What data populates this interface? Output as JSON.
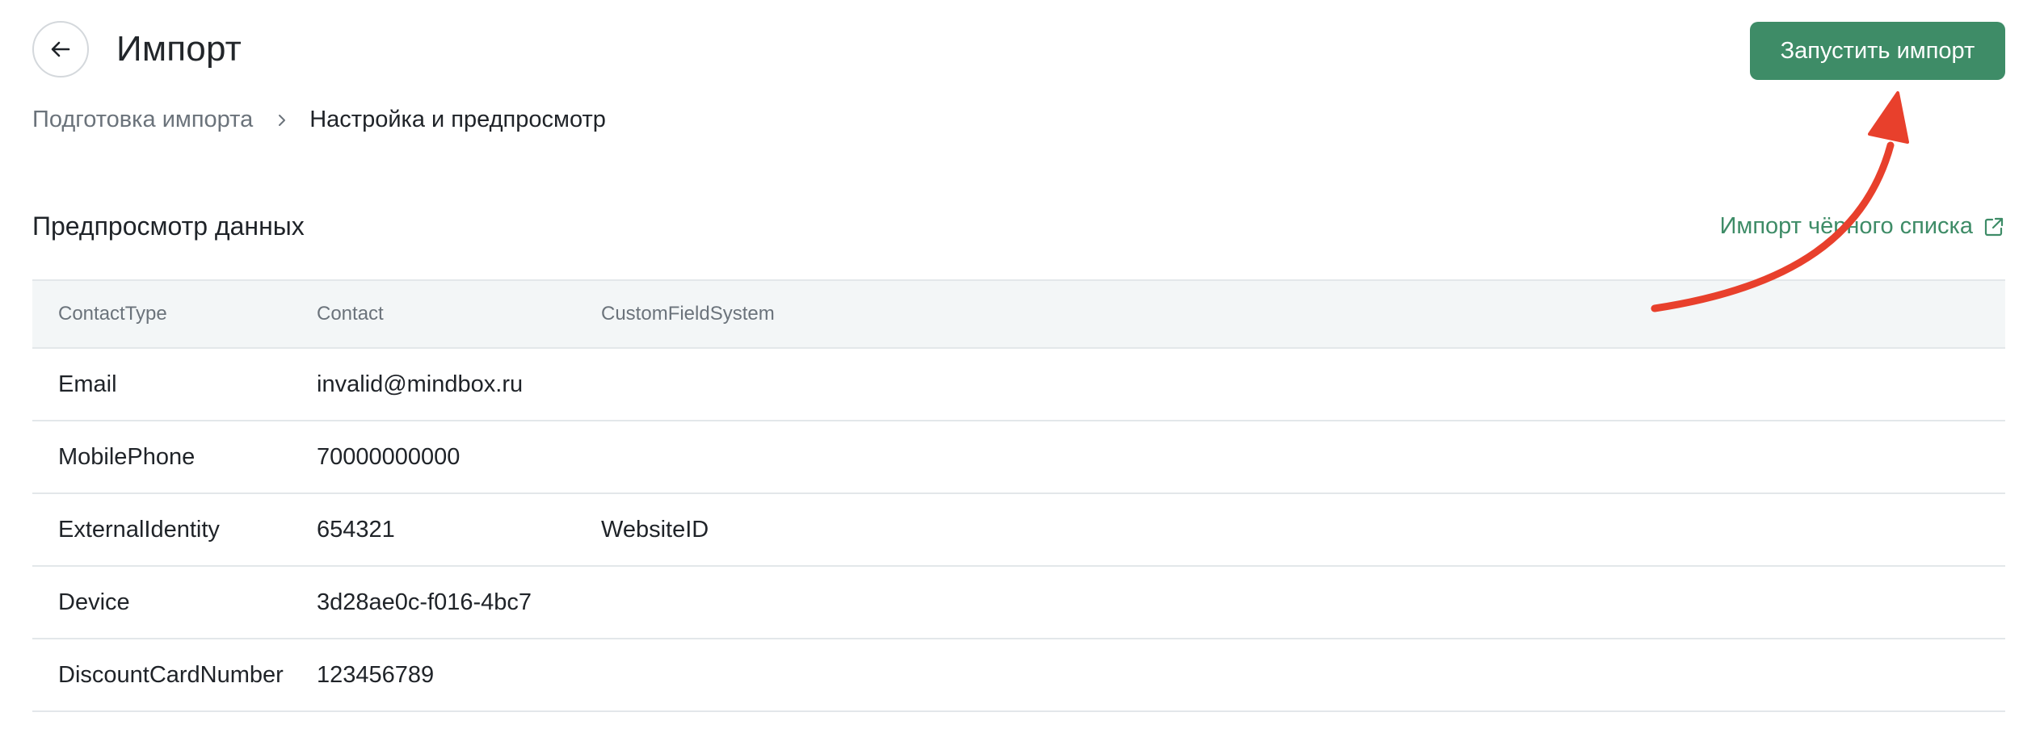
{
  "header": {
    "title": "Импорт",
    "run_button": "Запустить импорт"
  },
  "breadcrumb": {
    "previous": "Подготовка импорта",
    "current": "Настройка и предпросмотр"
  },
  "section": {
    "title": "Предпросмотр данных",
    "blacklist_link": "Импорт чёрного списка"
  },
  "table": {
    "columns": [
      "ContactType",
      "Contact",
      "CustomFieldSystem"
    ],
    "rows": [
      [
        "Email",
        "invalid@mindbox.ru",
        ""
      ],
      [
        "MobilePhone",
        "70000000000",
        ""
      ],
      [
        "ExternalIdentity",
        "654321",
        "WebsiteID"
      ],
      [
        "Device",
        "3d28ae0c-f016-4bc7",
        ""
      ],
      [
        "DiscountCardNumber",
        "123456789",
        ""
      ]
    ]
  },
  "icons": {
    "back": "arrow-left-icon",
    "separator": "chevron-right-icon",
    "external": "external-link-icon"
  },
  "colors": {
    "accent": "#3e8c67",
    "annotation_arrow": "#e8402c"
  }
}
